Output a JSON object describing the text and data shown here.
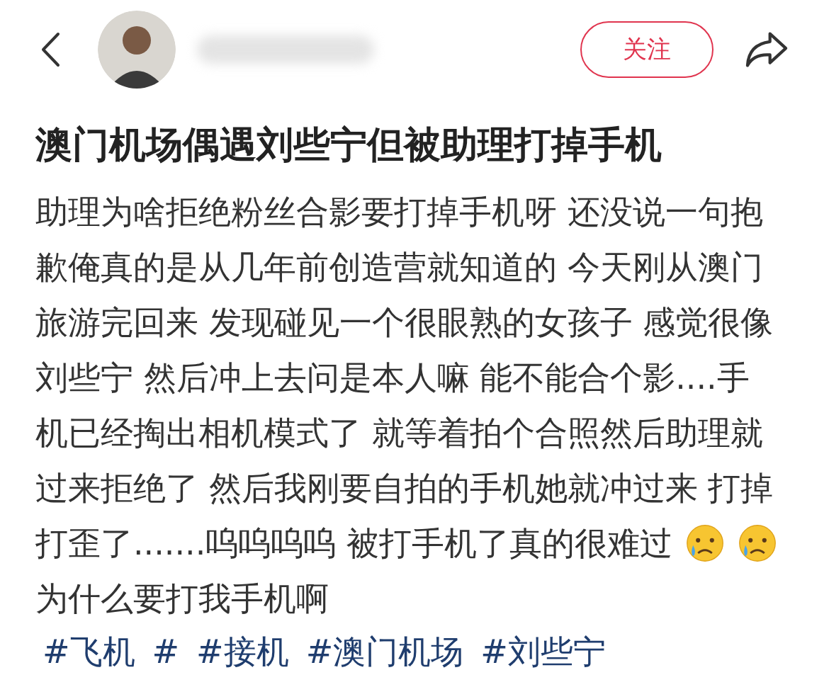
{
  "header": {
    "follow_button": "关注"
  },
  "post": {
    "title": "澳门机场偶遇刘些宁但被助理打掉手机",
    "body_lines": [
      [
        {
          "kind": "text",
          "text": "助理为啥拒绝粉丝合影要打掉手机呀 还没说一句抱"
        }
      ],
      [
        {
          "kind": "text",
          "text": "歉俺真的是从几年前创造营就知道的 今天刚从澳门"
        }
      ],
      [
        {
          "kind": "text",
          "text": "旅游完回来 发现碰见一个很眼熟的女孩子 感觉很像"
        }
      ],
      [
        {
          "kind": "text",
          "text": "刘些宁 然后冲上去问是本人嘛 能不能合个影....手"
        }
      ],
      [
        {
          "kind": "text",
          "text": "机已经掏出相机模式了 就等着拍个合照然后助理就"
        }
      ],
      [
        {
          "kind": "text",
          "text": "过来拒绝了 然后我刚要自拍的手机她就冲过来 打掉"
        }
      ],
      [
        {
          "kind": "text",
          "text": "打歪了.......呜呜呜呜 被打手机了真的很难过"
        },
        {
          "kind": "emoji"
        },
        {
          "kind": "emoji"
        }
      ],
      [
        {
          "kind": "text",
          "text": "为什么要打我手机啊"
        }
      ]
    ],
    "tags": [
      "#飞机",
      "#",
      "#接机",
      "#澳门机场",
      "#刘些宁"
    ]
  }
}
